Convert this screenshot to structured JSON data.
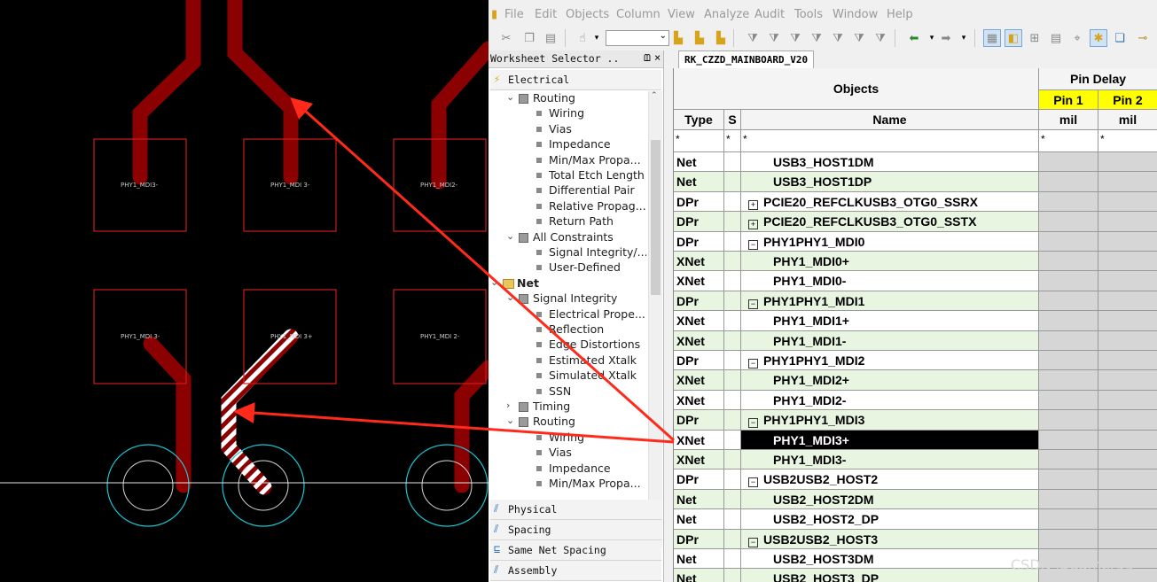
{
  "menu": [
    "File",
    "Edit",
    "Objects",
    "Column",
    "View",
    "Analyze",
    "Audit",
    "Tools",
    "Window",
    "Help"
  ],
  "worksheet_selector": {
    "title": "Worksheet Selector ..",
    "pin": "ᗶ",
    "close": "×",
    "top_category": "Electrical",
    "tree": [
      {
        "level": 1,
        "label": "Routing",
        "kind": "folder-grey",
        "expander": "⌄"
      },
      {
        "level": 2,
        "label": "Wiring",
        "kind": "sheet"
      },
      {
        "level": 2,
        "label": "Vias",
        "kind": "sheet"
      },
      {
        "level": 2,
        "label": "Impedance",
        "kind": "sheet"
      },
      {
        "level": 2,
        "label": "Min/Max Propa...",
        "kind": "sheet"
      },
      {
        "level": 2,
        "label": "Total Etch Length",
        "kind": "sheet"
      },
      {
        "level": 2,
        "label": "Differential Pair",
        "kind": "sheet"
      },
      {
        "level": 2,
        "label": "Relative Propag...",
        "kind": "sheet"
      },
      {
        "level": 2,
        "label": "Return Path",
        "kind": "sheet"
      },
      {
        "level": 1,
        "label": "All Constraints",
        "kind": "folder-grey",
        "expander": "⌄"
      },
      {
        "level": 2,
        "label": "Signal Integrity/...",
        "kind": "sheet"
      },
      {
        "level": 2,
        "label": "User-Defined",
        "kind": "sheet"
      },
      {
        "level": 0,
        "label": "Net",
        "kind": "folder-yellow",
        "expander": "⌄"
      },
      {
        "level": 1,
        "label": "Signal Integrity",
        "kind": "folder-grey",
        "expander": "⌄"
      },
      {
        "level": 2,
        "label": "Electrical Prope...",
        "kind": "sheet"
      },
      {
        "level": 2,
        "label": "Reflection",
        "kind": "sheet"
      },
      {
        "level": 2,
        "label": "Edge Distortions",
        "kind": "sheet"
      },
      {
        "level": 2,
        "label": "Estimated Xtalk",
        "kind": "sheet"
      },
      {
        "level": 2,
        "label": "Simulated Xtalk",
        "kind": "sheet"
      },
      {
        "level": 2,
        "label": "SSN",
        "kind": "sheet"
      },
      {
        "level": 1,
        "label": "Timing",
        "kind": "folder-grey",
        "expander": "›"
      },
      {
        "level": 1,
        "label": "Routing",
        "kind": "folder-grey",
        "expander": "⌄"
      },
      {
        "level": 2,
        "label": "Wiring",
        "kind": "sheet"
      },
      {
        "level": 2,
        "label": "Vias",
        "kind": "sheet"
      },
      {
        "level": 2,
        "label": "Impedance",
        "kind": "sheet"
      },
      {
        "level": 2,
        "label": "Min/Max Propa...",
        "kind": "sheet"
      }
    ],
    "bottom_categories": [
      "Physical",
      "Spacing",
      "Same Net Spacing",
      "Assembly"
    ]
  },
  "sheet_tab": "RK_CZZD_MAINBOARD_V20",
  "table": {
    "group_header": "Objects",
    "pin_delay_header": "Pin Delay",
    "pin1": "Pin 1",
    "pin2": "Pin 2",
    "unit1": "mil",
    "unit2": "mil",
    "col_type": "Type",
    "col_s": "S",
    "col_name": "Name",
    "filter_type": "*",
    "filter_s": "*",
    "filter_name": "*",
    "filter_pin1": "*",
    "filter_pin2": "*",
    "rows": [
      {
        "type": "Net",
        "name": "USB3_HOST1DM",
        "expander": ""
      },
      {
        "type": "Net",
        "name": "USB3_HOST1DP",
        "expander": ""
      },
      {
        "type": "DPr",
        "name": "PCIE20_REFCLKUSB3_OTG0_SSRX",
        "expander": "+"
      },
      {
        "type": "DPr",
        "name": "PCIE20_REFCLKUSB3_OTG0_SSTX",
        "expander": "+"
      },
      {
        "type": "DPr",
        "name": "PHY1PHY1_MDI0",
        "expander": "-"
      },
      {
        "type": "XNet",
        "name": "PHY1_MDI0+",
        "expander": ""
      },
      {
        "type": "XNet",
        "name": "PHY1_MDI0-",
        "expander": ""
      },
      {
        "type": "DPr",
        "name": "PHY1PHY1_MDI1",
        "expander": "-"
      },
      {
        "type": "XNet",
        "name": "PHY1_MDI1+",
        "expander": ""
      },
      {
        "type": "XNet",
        "name": "PHY1_MDI1-",
        "expander": ""
      },
      {
        "type": "DPr",
        "name": "PHY1PHY1_MDI2",
        "expander": "-"
      },
      {
        "type": "XNet",
        "name": "PHY1_MDI2+",
        "expander": ""
      },
      {
        "type": "XNet",
        "name": "PHY1_MDI2-",
        "expander": ""
      },
      {
        "type": "DPr",
        "name": "PHY1PHY1_MDI3",
        "expander": "-"
      },
      {
        "type": "XNet",
        "name": "PHY1_MDI3+",
        "expander": "",
        "selected": true
      },
      {
        "type": "XNet",
        "name": "PHY1_MDI3-",
        "expander": ""
      },
      {
        "type": "DPr",
        "name": "USB2USB2_HOST2",
        "expander": "-"
      },
      {
        "type": "Net",
        "name": "USB2_HOST2DM",
        "expander": ""
      },
      {
        "type": "Net",
        "name": "USB2_HOST2_DP",
        "expander": ""
      },
      {
        "type": "DPr",
        "name": "USB2USB2_HOST3",
        "expander": "-"
      },
      {
        "type": "Net",
        "name": "USB2_HOST3DM",
        "expander": ""
      },
      {
        "type": "Net",
        "name": "USB2_HOST3_DP",
        "expander": ""
      }
    ]
  },
  "pcb": {
    "pad_labels_row1": [
      "PHY1_MDI3-",
      "PHY1_MDI 3-",
      "PHY1_MDI2-"
    ],
    "pad_labels_row2": [
      "PHY1_MDI 3-",
      "PHY1_MDI 3+",
      "PHY1_MDI 2-"
    ]
  },
  "colors": {
    "trace": "#8b0000",
    "pad_outline": "#cc1d1d",
    "highlight_stripe": "#ffffff",
    "via_ring": "#18c8d8",
    "arrow": "#ff2a1a",
    "selected_row": "#000000",
    "pin_header_yellow": "#ffff00"
  },
  "watermark": "CSDN @gamer99"
}
